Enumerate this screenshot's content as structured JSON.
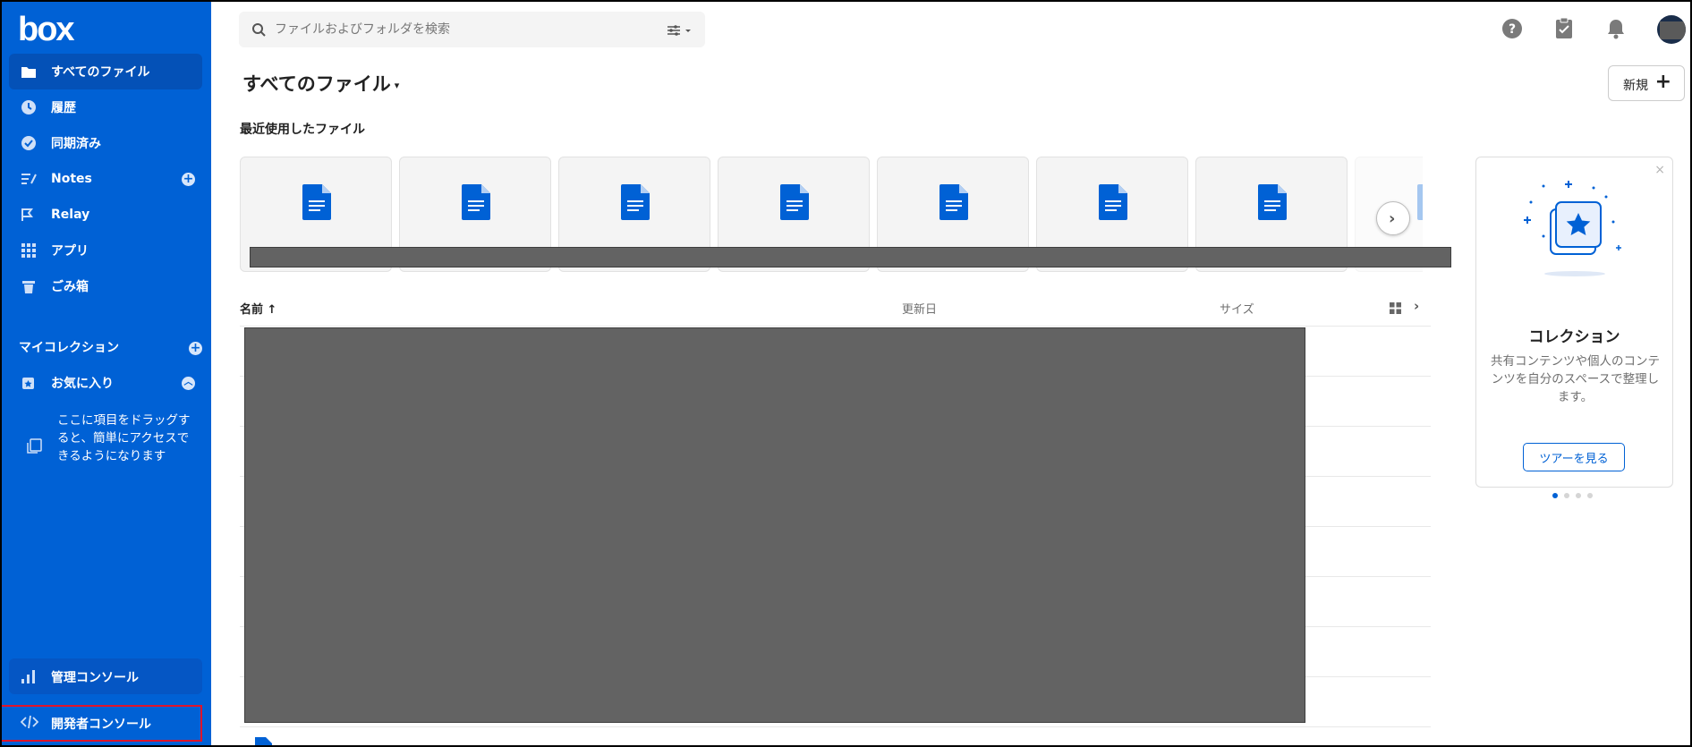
{
  "app": {
    "logo_text": "box"
  },
  "sidebar": {
    "items": [
      {
        "label": "すべてのファイル",
        "icon": "folder-icon",
        "active": true
      },
      {
        "label": "履歴",
        "icon": "clock-icon"
      },
      {
        "label": "同期済み",
        "icon": "check-circle-icon"
      },
      {
        "label": "Notes",
        "icon": "notes-icon",
        "has_add": true
      },
      {
        "label": "Relay",
        "icon": "relay-icon"
      },
      {
        "label": "アプリ",
        "icon": "apps-grid-icon"
      },
      {
        "label": "ごみ箱",
        "icon": "trash-icon"
      }
    ],
    "collections_title": "マイコレクション",
    "favorites_label": "お気に入り",
    "favorites_hint": "ここに項目をドラッグすると、簡単にアクセスできるようになります",
    "admin_console": "管理コンソール",
    "dev_console": "開発者コンソール"
  },
  "search": {
    "placeholder": "ファイルおよびフォルダを検索"
  },
  "topbar_icons": [
    "help-icon",
    "tasks-icon",
    "notifications-icon",
    "avatar"
  ],
  "header": {
    "title": "すべてのファイル",
    "new_button": "新規"
  },
  "recents": {
    "title": "最近使用したファイル",
    "card_count": 8
  },
  "list": {
    "columns": {
      "name": "名前",
      "updated": "更新日",
      "size": "サイズ"
    },
    "sort_indicator": "↑"
  },
  "collections_panel": {
    "title": "コレクション",
    "description": "共有コンテンツや個人のコンテンツを自分のスペースで整理します。",
    "tour_button": "ツアーを見る",
    "close": "×",
    "pager_count": 4,
    "pager_active": 1
  },
  "colors": {
    "brand": "#0061d5",
    "sidebar_active": "#0451b7",
    "highlight": "#e0142a"
  }
}
